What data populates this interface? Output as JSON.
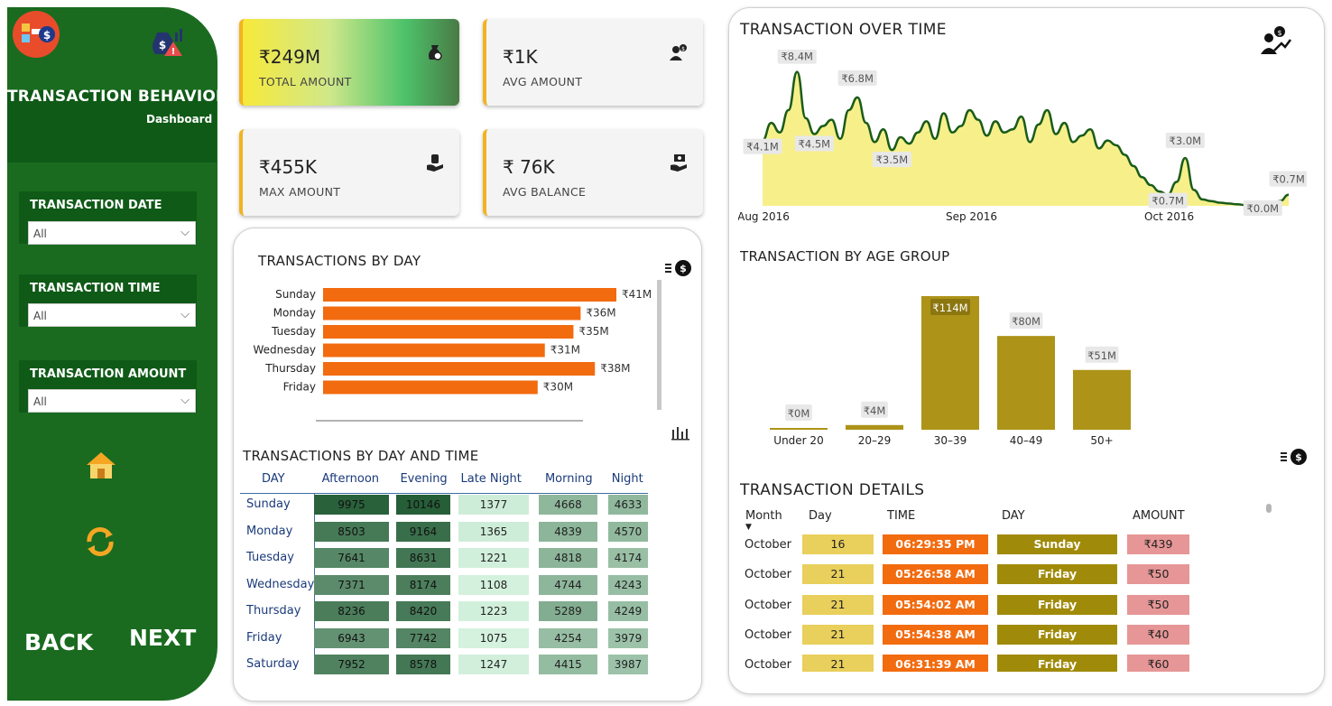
{
  "sidebar": {
    "title": "TRANSACTION BEHAVIOR",
    "subtitle": "Dashboard",
    "filters": [
      {
        "label": "TRANSACTION DATE",
        "value": "All"
      },
      {
        "label": "TRANSACTION TIME",
        "value": "All"
      },
      {
        "label": "TRANSACTION AMOUNT",
        "value": "All"
      }
    ],
    "back_label": "BACK",
    "next_label": "NEXT",
    "icons": [
      "logo-icon",
      "money-bag-alert-icon",
      "home-icon",
      "refresh-icon"
    ]
  },
  "kpis": [
    {
      "value": "₹249M",
      "label": "TOTAL AMOUNT",
      "icon": "money-bag-icon"
    },
    {
      "value": "₹1K",
      "label": "AVG AMOUNT",
      "icon": "user-money-icon"
    },
    {
      "value": "₹455K",
      "label": "MAX AMOUNT",
      "icon": "hand-money-icon"
    },
    {
      "value": "₹ 76K",
      "label": "AVG BALANCE",
      "icon": "hand-cash-icon"
    }
  ],
  "colors": {
    "sidebar": "#1a6b1f",
    "bar_orange": "#f26b0f",
    "age_bar": "#ad9318",
    "area_fill": "#f7f08a",
    "line": "#1a5c1a"
  },
  "chart_data": [
    {
      "type": "area",
      "title": "TRANSACTION OVER TIME",
      "x_ticks": [
        "Aug 2016",
        "Sep 2016",
        "Oct 2016"
      ],
      "unit": "₹M",
      "series": [
        {
          "values": [
            4.1,
            5.2,
            4.6,
            6.0,
            8.4,
            5.5,
            4.5,
            5.0,
            5.4,
            4.2,
            6.0,
            6.8,
            5.2,
            4.0,
            4.8,
            3.5,
            4.3,
            3.9,
            4.6,
            5.3,
            4.2,
            5.8,
            4.6,
            5.0,
            6.0,
            5.4,
            4.4,
            5.3,
            4.6,
            4.8,
            5.6,
            4.0,
            5.1,
            6.0,
            4.5,
            5.2,
            4.0,
            4.4,
            4.8,
            3.6,
            4.1,
            3.8,
            3.2,
            2.5,
            1.8,
            1.3,
            0.9,
            0.7,
            1.5,
            3.0,
            1.0,
            0.4,
            0.3,
            0.2,
            0.15,
            0.1,
            0.05,
            0.02,
            0.0,
            0.05,
            0.3,
            0.7
          ]
        }
      ],
      "data_labels": [
        "₹8.4M",
        "₹6.8M",
        "₹4.5M",
        "₹4.1M",
        "₹3.5M",
        "₹3.0M",
        "₹0.7M",
        "₹0.0M",
        "₹0.7M"
      ]
    },
    {
      "type": "bar",
      "title": "TRANSACTIONS BY DAY",
      "orientation": "horizontal",
      "categories": [
        "Sunday",
        "Monday",
        "Tuesday",
        "Wednesday",
        "Thursday",
        "Friday"
      ],
      "values": [
        41,
        36,
        35,
        31,
        38,
        30
      ],
      "labels": [
        "₹41M",
        "₹36M",
        "₹35M",
        "₹31M",
        "₹38M",
        "₹30M"
      ]
    },
    {
      "type": "bar",
      "title": "TRANSACTION BY AGE GROUP",
      "categories": [
        "Under 20",
        "20–29",
        "30–39",
        "40–49",
        "50+"
      ],
      "values": [
        0,
        4,
        114,
        80,
        51
      ],
      "labels": [
        "₹0M",
        "₹4M",
        "₹114M",
        "₹80M",
        "₹51M"
      ]
    },
    {
      "type": "heatmap",
      "title": "TRANSACTIONS BY DAY AND TIME",
      "columns": [
        "DAY",
        "Afternoon",
        "Evening",
        "Late Night",
        "Morning",
        "Night"
      ],
      "rows": [
        {
          "day": "Sunday",
          "values": [
            9975,
            10146,
            1377,
            4668,
            4633
          ]
        },
        {
          "day": "Monday",
          "values": [
            8503,
            9164,
            1365,
            4839,
            4570
          ]
        },
        {
          "day": "Tuesday",
          "values": [
            7641,
            8631,
            1221,
            4818,
            4174
          ]
        },
        {
          "day": "Wednesday",
          "values": [
            7371,
            8174,
            1108,
            4744,
            4243
          ]
        },
        {
          "day": "Thursday",
          "values": [
            8236,
            8420,
            1223,
            5289,
            4249
          ]
        },
        {
          "day": "Friday",
          "values": [
            6943,
            7742,
            1075,
            4254,
            3979
          ]
        },
        {
          "day": "Saturday",
          "values": [
            7952,
            8578,
            1247,
            4415,
            3987
          ]
        }
      ]
    },
    {
      "type": "table",
      "title": "TRANSACTION DETAILS",
      "columns": [
        "Month",
        "Day",
        "TIME",
        "DAY",
        "AMOUNT"
      ],
      "rows": [
        [
          "October",
          "16",
          "06:29:35 PM",
          "Sunday",
          "₹439"
        ],
        [
          "October",
          "21",
          "05:26:58 AM",
          "Friday",
          "₹50"
        ],
        [
          "October",
          "21",
          "05:54:02 AM",
          "Friday",
          "₹50"
        ],
        [
          "October",
          "21",
          "05:54:38 AM",
          "Friday",
          "₹40"
        ],
        [
          "October",
          "21",
          "06:31:39 AM",
          "Friday",
          "₹60"
        ]
      ]
    }
  ]
}
